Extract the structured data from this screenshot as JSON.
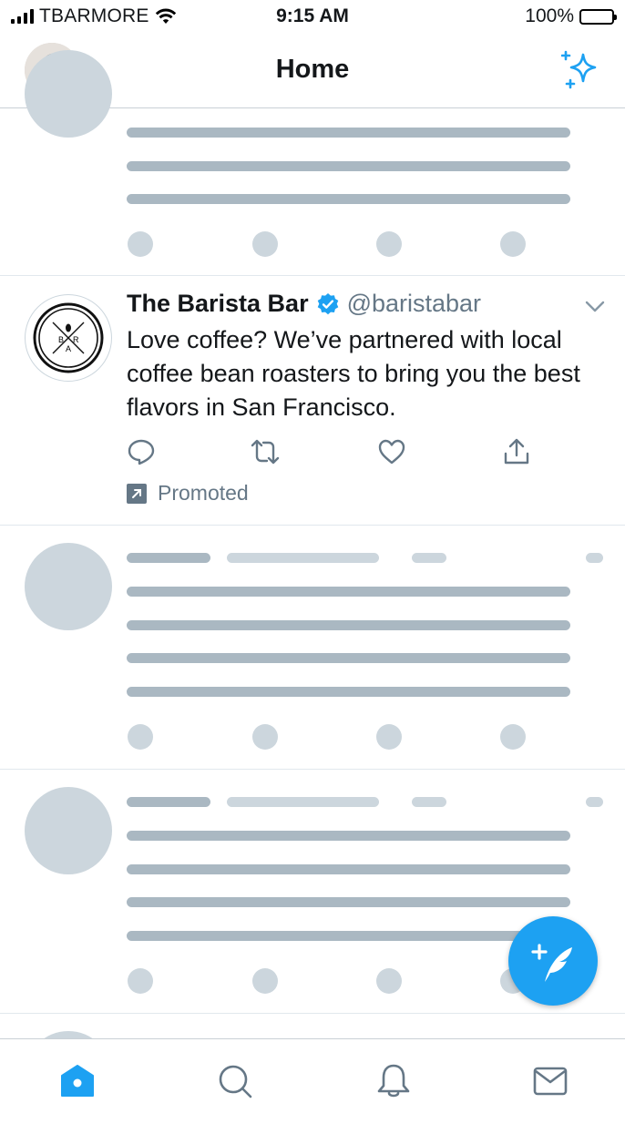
{
  "status_bar": {
    "carrier": "TBARMORE",
    "time": "9:15 AM",
    "battery": "100%"
  },
  "header": {
    "title": "Home",
    "avatar_icon": "user-avatar",
    "sparkle_icon": "sparkle-icon"
  },
  "tweet": {
    "name": "The Barista Bar",
    "handle": "@baristabar",
    "text": "Love coffee? We’ve partnered with local coffee bean roasters to bring you the best flavors in San Francisco.",
    "promoted_label": "Promoted",
    "logo_letters": [
      "B",
      "A",
      "R"
    ]
  },
  "tabs": [
    "home-icon",
    "search-icon",
    "notifications-icon",
    "messages-icon"
  ],
  "colors": {
    "accent": "#1da1f2",
    "skeleton_dark": "#aab8c2",
    "skeleton_light": "#ccd6dd",
    "muted": "#657786"
  }
}
